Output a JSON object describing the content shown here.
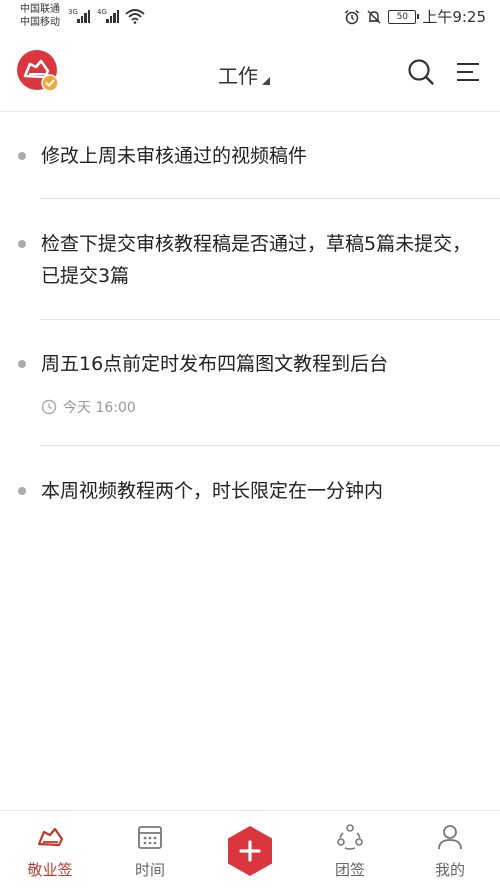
{
  "status_bar": {
    "carrier1": "中国联通",
    "carrier2": "中国移动",
    "signal1": "3G",
    "signal2": "4G",
    "battery": "50",
    "time": "上午9:25"
  },
  "header": {
    "title": "工作",
    "accent_color": "#d9363e"
  },
  "tasks": [
    {
      "text": "修改上周未审核通过的视频稿件"
    },
    {
      "text": "检查下提交审核教程稿是否通过，草稿5篇未提交，已提交3篇"
    },
    {
      "text": "周五16点前定时发布四篇图文教程到后台",
      "time": "今天 16:00"
    },
    {
      "text": "本周视频教程两个，时长限定在一分钟内"
    }
  ],
  "nav": {
    "items": [
      {
        "label": "敬业签",
        "icon": "logo-icon",
        "active": true
      },
      {
        "label": "时间",
        "icon": "calendar-icon",
        "active": false
      },
      {
        "label": "",
        "icon": "add-icon",
        "active": false
      },
      {
        "label": "团签",
        "icon": "team-icon",
        "active": false
      },
      {
        "label": "我的",
        "icon": "user-icon",
        "active": false
      }
    ]
  }
}
